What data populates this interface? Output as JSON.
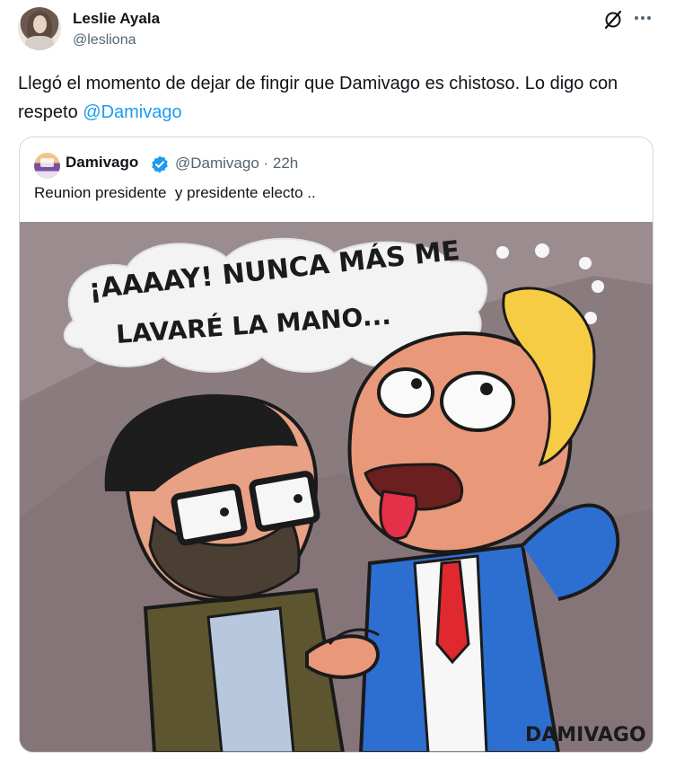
{
  "tweet": {
    "author_name": "Leslie Ayala",
    "author_handle": "@lesliona",
    "text_main": "Llegó el momento de dejar de fingir que Damivago es chistoso. Lo digo con respeto ",
    "mention": "@Damivago",
    "more_icon": "more-icon",
    "grok_icon": "grok-icon"
  },
  "quote": {
    "author_name": "Damivago",
    "author_handle": "@Damivago · 22h",
    "verified_icon": "verified-badge-icon",
    "text": "Reunion presidente  y presidente electo ..",
    "image": {
      "bubble_line1": "¡AAAAY! NUNCA MÁS ME",
      "bubble_line2": "LAVARÉ LA MANO...",
      "signature": "DAMIVAGO"
    }
  },
  "colors": {
    "link": "#1d9bf0",
    "secondary_text": "#536471",
    "border": "#cfd9de",
    "cartoon_bg": "#9a8c8f"
  }
}
